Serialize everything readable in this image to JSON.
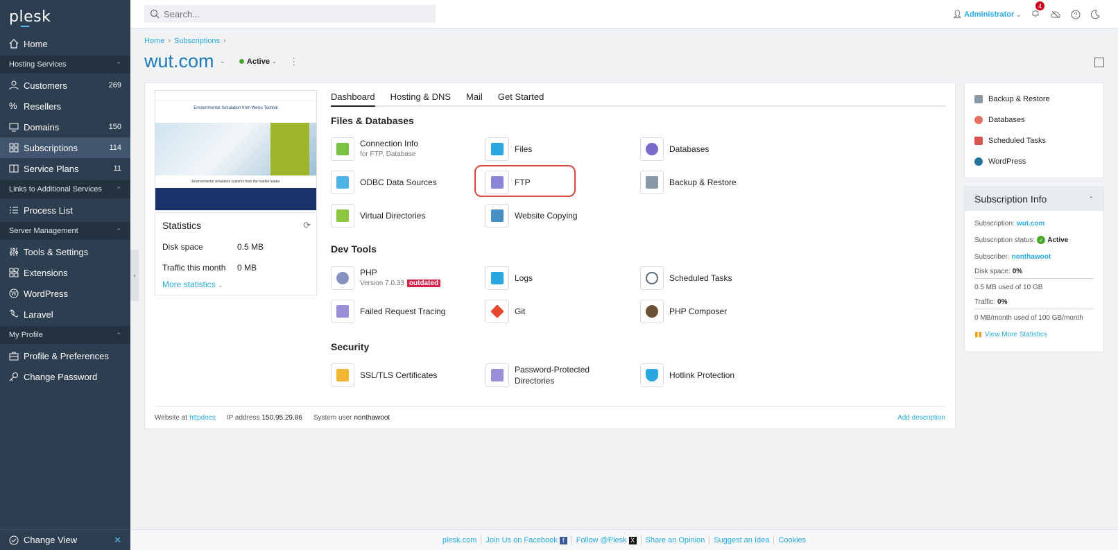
{
  "brand": "plesk",
  "sidebar": {
    "items_top": [
      {
        "label": "Home"
      }
    ],
    "groups": [
      {
        "title": "Hosting Services",
        "items": [
          {
            "label": "Customers",
            "count": "269"
          },
          {
            "label": "Resellers",
            "count": ""
          },
          {
            "label": "Domains",
            "count": "150"
          },
          {
            "label": "Subscriptions",
            "count": "114"
          },
          {
            "label": "Service Plans",
            "count": "11"
          }
        ]
      },
      {
        "title": "Links to Additional Services",
        "items": [
          {
            "label": "Process List"
          }
        ]
      },
      {
        "title": "Server Management",
        "items": [
          {
            "label": "Tools & Settings"
          },
          {
            "label": "Extensions"
          },
          {
            "label": "WordPress"
          },
          {
            "label": "Laravel"
          }
        ]
      },
      {
        "title": "My Profile",
        "items": [
          {
            "label": "Profile & Preferences"
          },
          {
            "label": "Change Password"
          }
        ]
      }
    ],
    "change_view": "Change View"
  },
  "topbar": {
    "search_placeholder": "Search...",
    "user": "Administrator",
    "notifications": "4"
  },
  "breadcrumb": [
    "Home",
    "Subscriptions"
  ],
  "page": {
    "title": "wut.com",
    "status": "Active"
  },
  "preview": {
    "headline": "Environmental Simulation from Weiss Technik",
    "subline": "Environmental simulation systems from the market leader"
  },
  "statistics": {
    "title": "Statistics",
    "disk_label": "Disk space",
    "disk_value": "0.5 MB",
    "traffic_label": "Traffic this month",
    "traffic_value": "0 MB",
    "more": "More statistics"
  },
  "tabs": [
    "Dashboard",
    "Hosting & DNS",
    "Mail",
    "Get Started"
  ],
  "sections": {
    "files": "Files & Databases",
    "dev": "Dev Tools",
    "security": "Security"
  },
  "tiles": {
    "connection_info": "Connection Info",
    "connection_info_sub": "for FTP, Database",
    "files": "Files",
    "databases": "Databases",
    "odbc": "ODBC Data Sources",
    "ftp": "FTP",
    "backup": "Backup & Restore",
    "vdirs": "Virtual Directories",
    "website_copying": "Website Copying",
    "php": "PHP",
    "php_version": "Version 7.0.33",
    "php_badge": "outdated",
    "logs": "Logs",
    "scheduled_tasks": "Scheduled Tasks",
    "failed_request": "Failed Request Tracing",
    "git": "Git",
    "php_composer": "PHP Composer",
    "ssl": "SSL/TLS Certificates",
    "pwd_dirs": "Password-Protected Directories",
    "hotlink": "Hotlink Protection"
  },
  "card_footer": {
    "website_at": "Website at",
    "website_at_value": "httpdocs",
    "ip_label": "IP address",
    "ip_value": "150.95.29.86",
    "sysuser_label": "System user",
    "sysuser_value": "nonthawoot",
    "add_description": "Add description"
  },
  "right_links": [
    "Backup & Restore",
    "Databases",
    "Scheduled Tasks",
    "WordPress"
  ],
  "sub_info": {
    "title": "Subscription Info",
    "subscription_label": "Subscription:",
    "subscription_value": "wut.com",
    "status_label": "Subscription status:",
    "status_value": "Active",
    "subscriber_label": "Subscriber:",
    "subscriber_value": "nonthawoot",
    "disk_label": "Disk space:",
    "disk_value": "0%",
    "disk_used": "0.5 MB used of 10 GB",
    "traffic_label": "Traffic:",
    "traffic_value": "0%",
    "traffic_used": "0 MB/month used of 100 GB/month",
    "view_more": "View More Statistics"
  },
  "footer": [
    "plesk.com",
    "Join Us on Facebook",
    "Follow @Plesk",
    "Share an Opinion",
    "Suggest an Idea",
    "Cookies"
  ],
  "colors": {
    "sidebar": "#2d3e50",
    "accent": "#28aade",
    "title": "#1c7ab6",
    "highlight": "#d9463e",
    "active_green": "#4ca62a"
  }
}
